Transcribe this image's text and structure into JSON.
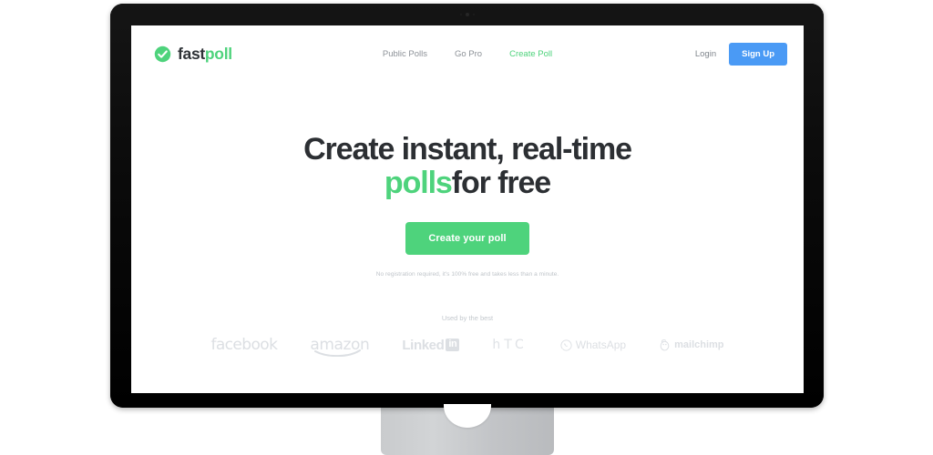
{
  "device": {
    "type": "desktop-monitor-mockup",
    "bezel_color": "#0c0c0c",
    "stand_color": "#c9cbcd"
  },
  "site": {
    "logo": {
      "icon": "check-circle-icon",
      "text_primary": "fast",
      "text_accent": "poll",
      "accent_color": "#4ed37c"
    },
    "nav": [
      {
        "label": "Public Polls",
        "active": false
      },
      {
        "label": "Go Pro",
        "active": false
      },
      {
        "label": "Create Poll",
        "active": true
      }
    ],
    "account": {
      "login_label": "Login",
      "signup_label": "Sign Up",
      "signup_color": "#4a9af5"
    },
    "hero": {
      "title_line1": "Create instant, real-time",
      "title_accent": "polls",
      "title_line2_rest": " for free",
      "cta_label": "Create your poll",
      "cta_color": "#4ed37c",
      "note": "No registration required, it's 100% free and takes less than a minute.",
      "highlight_color": "#fdf6c0"
    },
    "social_proof": {
      "label": "Used by the best",
      "brands": [
        {
          "name": "facebook",
          "icon": "facebook-wordmark"
        },
        {
          "name": "amazon",
          "icon": "amazon-wordmark"
        },
        {
          "name": "Linked",
          "badge": "in",
          "icon": "linkedin-wordmark"
        },
        {
          "name": "hTC",
          "icon": "htc-wordmark"
        },
        {
          "name": "WhatsApp",
          "icon": "whatsapp-icon"
        },
        {
          "name": "mailchimp",
          "icon": "mailchimp-icon"
        }
      ]
    }
  }
}
